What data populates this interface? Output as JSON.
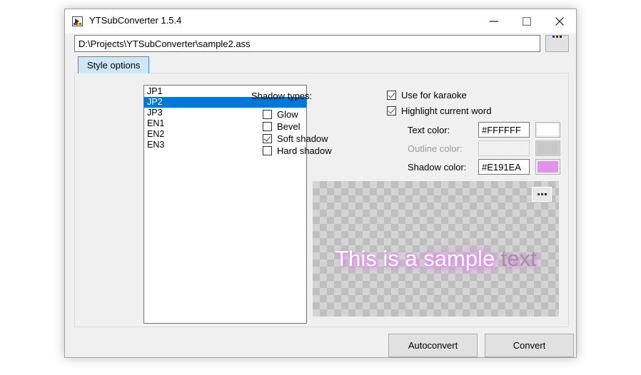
{
  "window": {
    "title": "YTSubConverter 1.5.4",
    "app_icon": "app-window-icon",
    "controls": {
      "minimize": "minimize-icon",
      "maximize": "maximize-icon",
      "close": "close-icon"
    }
  },
  "path_bar": {
    "value": "D:\\Projects\\YTSubConverter\\sample2.ass",
    "placeholder": "",
    "browse_label": "..."
  },
  "tabs": [
    {
      "label": "Style options",
      "selected": true
    }
  ],
  "style_list": {
    "items": [
      {
        "label": "JP1",
        "selected": false
      },
      {
        "label": "JP2",
        "selected": true
      },
      {
        "label": "JP3",
        "selected": false
      },
      {
        "label": "EN1",
        "selected": false
      },
      {
        "label": "EN2",
        "selected": false
      },
      {
        "label": "EN3",
        "selected": false
      }
    ]
  },
  "shadow_types": {
    "group_label": "Shadow types:",
    "options": [
      {
        "label": "Glow",
        "checked": false
      },
      {
        "label": "Bevel",
        "checked": false
      },
      {
        "label": "Soft shadow",
        "checked": true
      },
      {
        "label": "Hard shadow",
        "checked": false
      }
    ]
  },
  "karaoke": {
    "use_for_karaoke": {
      "label": "Use for karaoke",
      "checked": true
    },
    "highlight_current_word": {
      "label": "Highlight current word",
      "checked": true
    }
  },
  "colors": {
    "text": {
      "label": "Text color:",
      "value": "#FFFFFF",
      "swatch": "#FFFFFF",
      "disabled": false
    },
    "outline": {
      "label": "Outline color:",
      "value": "",
      "swatch": "#C8C8C8",
      "disabled": true
    },
    "shadow": {
      "label": "Shadow color:",
      "value": "#E191EA",
      "swatch": "#E191EA",
      "disabled": false
    }
  },
  "preview": {
    "browse_label": "...",
    "sample_text_segments": [
      {
        "text": "This is a ",
        "state": "sung"
      },
      {
        "text": "sample",
        "state": "current"
      },
      {
        "text": " text",
        "state": "unsung"
      }
    ]
  },
  "actions": {
    "autoconvert_label": "Autoconvert",
    "convert_label": "Convert"
  }
}
